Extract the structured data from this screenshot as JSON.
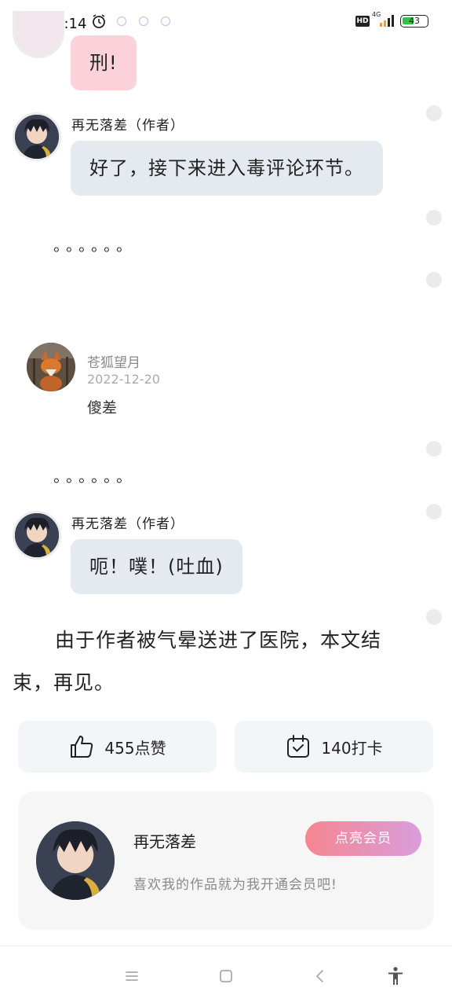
{
  "status_bar": {
    "time": "下午2:14",
    "network": "4G",
    "hd": "HD",
    "battery": "43"
  },
  "messages": [
    {
      "type": "bubble",
      "text": "刑!",
      "style": "pink"
    },
    {
      "type": "bubble",
      "speaker": "再无落差（作者）",
      "text": "好了，接下来进入毒评论环节。",
      "style": "gray"
    },
    {
      "type": "dots",
      "text": "。。。。。。"
    },
    {
      "type": "comment",
      "user": "苍狐望月",
      "date": "2022-12-20",
      "text": "傻差"
    },
    {
      "type": "dots",
      "text": "。。。。。。"
    },
    {
      "type": "bubble",
      "speaker": "再无落差（作者）",
      "text": "呃！噗！(吐血)",
      "style": "gray"
    }
  ],
  "ending": "由于作者被气晕送进了医院，本文结束，再见。",
  "actions": {
    "like_label": "455点赞",
    "checkin_label": "140打卡"
  },
  "author_card": {
    "name": "再无落差",
    "member_button": "点亮会员",
    "slogan": "喜欢我的作品就为我开通会员吧!"
  },
  "icons": {
    "like": "thumb-up-icon",
    "checkin": "calendar-check-icon",
    "menu": "menu-icon",
    "home": "square-home-icon",
    "back": "back-chevron-icon",
    "accessibility": "accessibility-icon"
  },
  "colors": {
    "pink_bubble": "#fbd1da",
    "gray_bubble": "#e5eaf0",
    "member_gradient_start": "#f6868f",
    "member_gradient_end": "#d99ddd"
  }
}
